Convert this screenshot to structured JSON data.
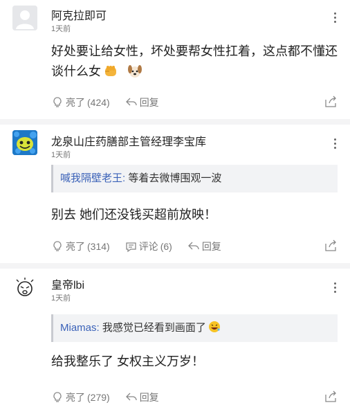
{
  "comments": [
    {
      "name": "阿克拉即可",
      "time": "1天前",
      "text": "好处要让给女性，坏处要帮女性扛着，这点都不懂还谈什么女",
      "like_label": "亮了",
      "like_count": "(424)",
      "reply_label": "回复",
      "emojis": [
        "fist-emoji",
        "dog-emoji"
      ]
    },
    {
      "name": "龙泉山庄药膳部主管经理李宝库",
      "time": "1天前",
      "quote_user": "喊我隔壁老王:",
      "quote_text": "等着去微博围观一波",
      "text": "别去 她们还没钱买超前放映！",
      "like_label": "亮了",
      "like_count": "(314)",
      "comment_label": "评论",
      "comment_count": "(6)",
      "reply_label": "回复"
    },
    {
      "name": "皇帝lbi",
      "time": "1天前",
      "quote_user": "Miamas:",
      "quote_text": "我感觉已经看到画面了",
      "text": "给我整乐了 女权主义万岁！",
      "like_label": "亮了",
      "like_count": "(279)",
      "reply_label": "回复",
      "emojis": [
        "rofl-emoji"
      ]
    }
  ],
  "colors": {
    "quote_user": "#3b62b8",
    "meta": "#777777",
    "divider": "#f4f4f5",
    "quote_bg": "#f2f3f5"
  }
}
